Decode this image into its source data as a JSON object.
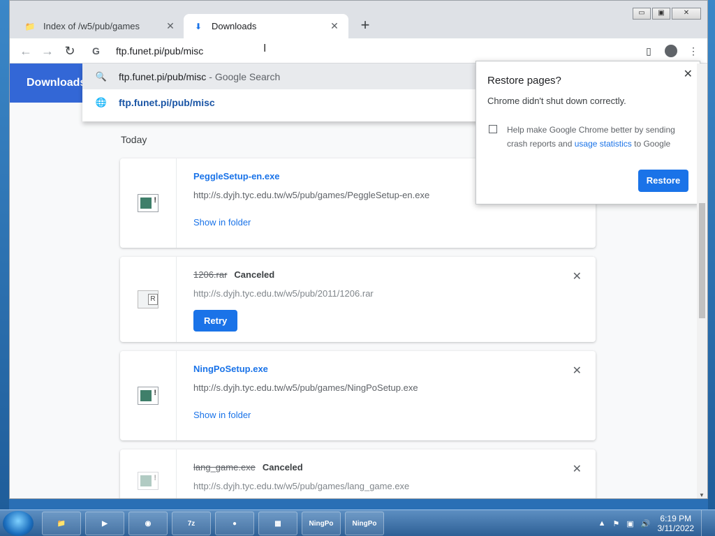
{
  "tabs": [
    {
      "title": "Index of /w5/pub/games",
      "favicon": "folder-globe-icon"
    },
    {
      "title": "Downloads",
      "favicon": "download-icon"
    }
  ],
  "window_buttons": {
    "minimize": "▭",
    "maximize": "▣",
    "close": "✕"
  },
  "toolbar": {
    "back": "←",
    "forward": "→",
    "reload": "↻",
    "address_value": "ftp.funet.pi/pub/misc"
  },
  "omnibox_suggestions": [
    {
      "text": "ftp.funet.pi/pub/misc",
      "sub": "- Google Search",
      "icon": "search-icon"
    },
    {
      "text": "ftp.funet.pi/pub/misc",
      "icon": "globe-icon"
    }
  ],
  "downloads": {
    "header_title": "Downloads",
    "section_label": "Today",
    "items": [
      {
        "name": "PeggleSetup-en.exe",
        "status": "",
        "url": "http://s.dyjh.tyc.edu.tw/w5/pub/games/PeggleSetup-en.exe",
        "action": "Show in folder"
      },
      {
        "name": "1206.rar",
        "status": "Canceled",
        "url": "http://s.dyjh.tyc.edu.tw/w5/pub/2011/1206.rar",
        "action": "Retry"
      },
      {
        "name": "NingPoSetup.exe",
        "status": "",
        "url": "http://s.dyjh.tyc.edu.tw/w5/pub/games/NingPoSetup.exe",
        "action": "Show in folder"
      },
      {
        "name": "lang_game.exe",
        "status": "Canceled",
        "url": "http://s.dyjh.tyc.edu.tw/w5/pub/games/lang_game.exe",
        "action": ""
      }
    ]
  },
  "restore_bubble": {
    "title": "Restore pages?",
    "message": "Chrome didn't shut down correctly.",
    "checkbox_text_1": "Help make Google Chrome better by sending crash reports and",
    "checkbox_link": "usage statistics",
    "checkbox_text_2": "to Google",
    "button": "Restore"
  },
  "taskbar": {
    "time": "6:19 PM",
    "date": "3/11/2022",
    "apps": [
      "explorer",
      "media-player",
      "chrome",
      "7-zip",
      "angry-birds",
      "control-panel",
      "ningpo",
      "ningpo"
    ],
    "app_labels": {
      "sevenzip": "7z",
      "ningpo": "NingPo"
    }
  },
  "colors": {
    "accent": "#1a73e8",
    "header": "#3367d6"
  }
}
